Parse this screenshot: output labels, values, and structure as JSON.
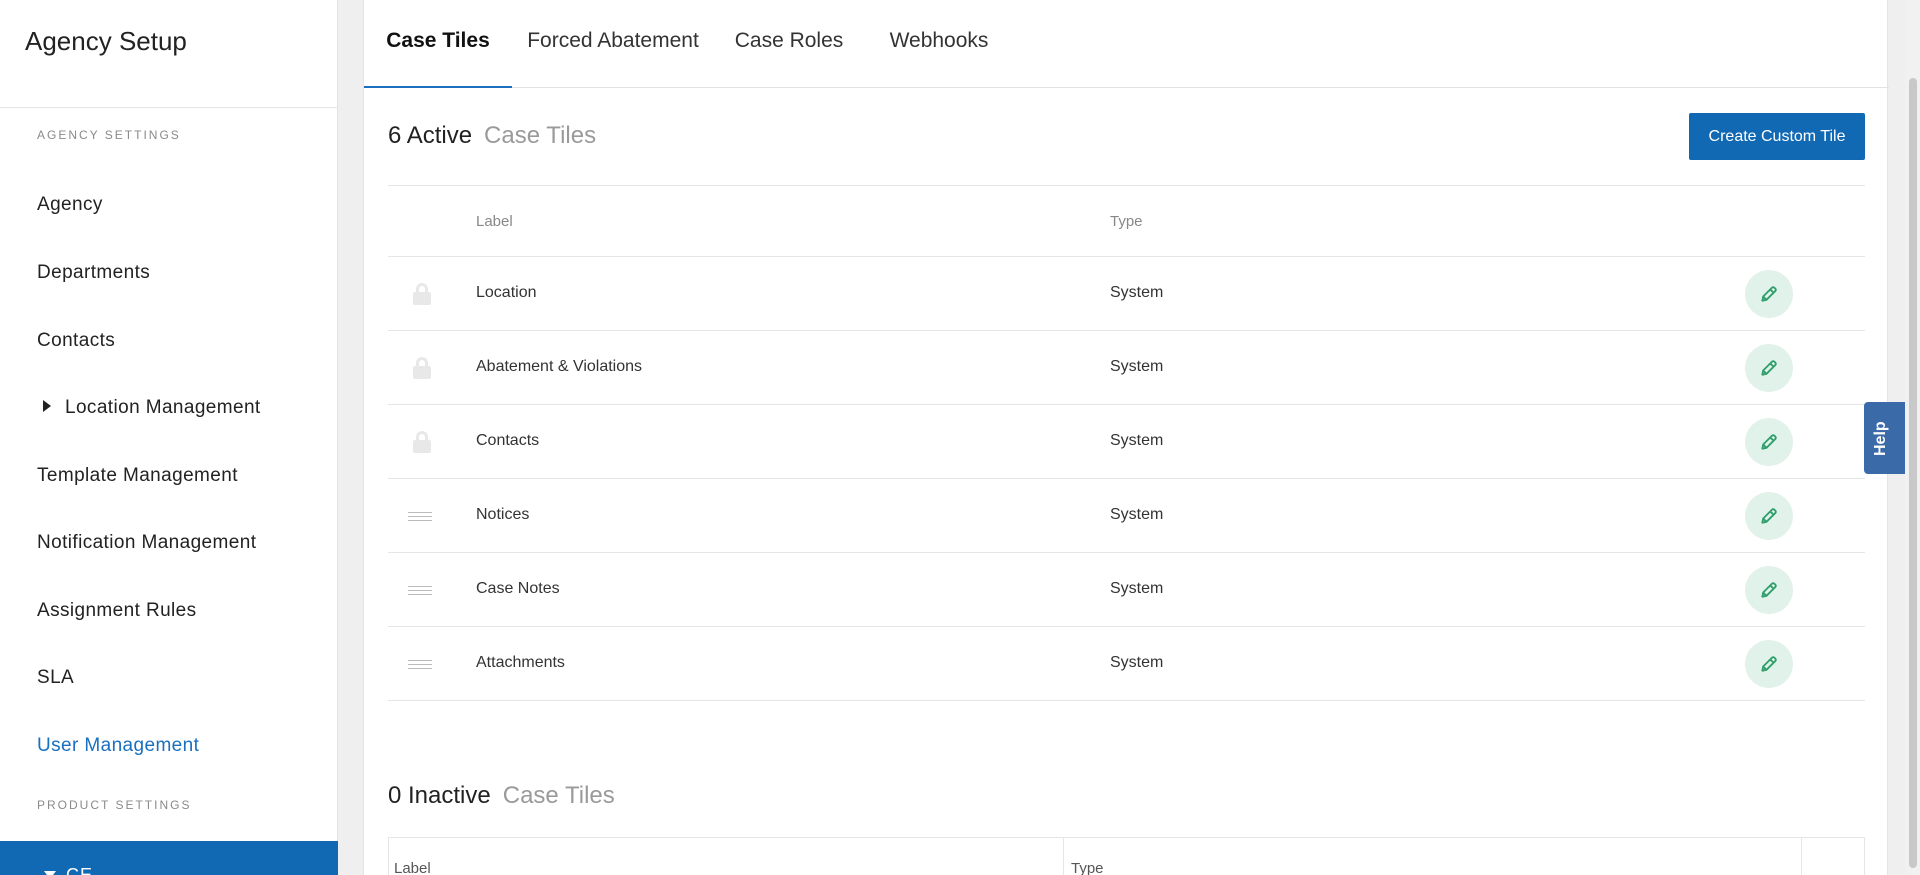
{
  "sidebar": {
    "title": "Agency Setup",
    "section_agency": "AGENCY SETTINGS",
    "items": [
      {
        "label": "Agency"
      },
      {
        "label": "Departments"
      },
      {
        "label": "Contacts"
      },
      {
        "label": "Location Management"
      },
      {
        "label": "Template Management"
      },
      {
        "label": "Notification Management"
      },
      {
        "label": "Assignment Rules"
      },
      {
        "label": "SLA"
      },
      {
        "label": "User Management"
      }
    ],
    "section_product": "PRODUCT SETTINGS",
    "product_item": "CE"
  },
  "tabs": [
    {
      "label": "Case Tiles"
    },
    {
      "label": "Forced Abatement"
    },
    {
      "label": "Case Roles"
    },
    {
      "label": "Webhooks"
    }
  ],
  "active_section": {
    "count": "6 Active",
    "suffix": "Case Tiles",
    "create_button": "Create Custom Tile",
    "columns": {
      "label": "Label",
      "type": "Type"
    },
    "rows": [
      {
        "label": "Location",
        "type": "System",
        "icon": "lock-icon"
      },
      {
        "label": "Abatement & Violations",
        "type": "System",
        "icon": "lock-icon"
      },
      {
        "label": "Contacts",
        "type": "System",
        "icon": "lock-icon"
      },
      {
        "label": "Notices",
        "type": "System",
        "icon": "drag-handle-icon"
      },
      {
        "label": "Case Notes",
        "type": "System",
        "icon": "drag-handle-icon"
      },
      {
        "label": "Attachments",
        "type": "System",
        "icon": "drag-handle-icon"
      }
    ]
  },
  "inactive_section": {
    "count": "0 Inactive",
    "suffix": "Case Tiles",
    "columns": {
      "label": "Label",
      "type": "Type"
    }
  },
  "help_tab": "Help",
  "colors": {
    "accent": "#1168b3",
    "edit_bg": "#e1f2ea",
    "edit_icon": "#2f9e6a"
  }
}
